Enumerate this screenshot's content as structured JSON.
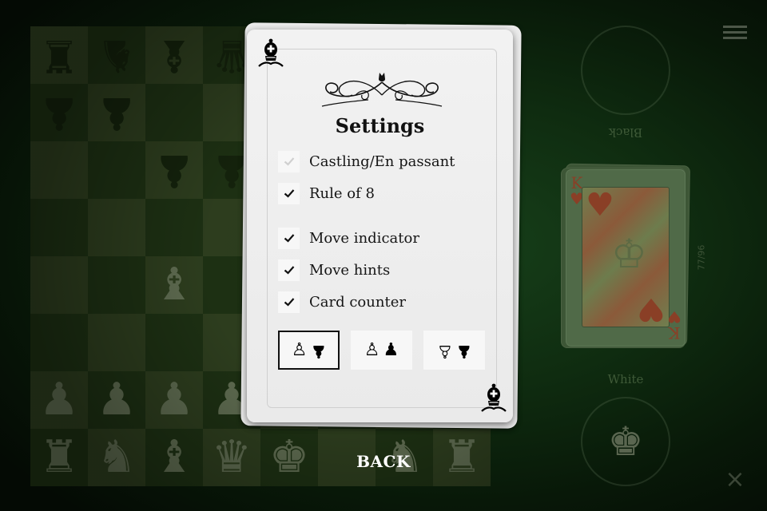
{
  "board": {
    "rows": [
      [
        "bR",
        "bN",
        "bB",
        "bQ",
        "",
        "",
        "",
        ""
      ],
      [
        "bP",
        "bP",
        "",
        "",
        "",
        "",
        "",
        ""
      ],
      [
        "",
        "",
        "bP",
        "bP",
        "",
        "",
        "",
        ""
      ],
      [
        "",
        "",
        "",
        "",
        "",
        "",
        "",
        ""
      ],
      [
        "",
        "",
        "wB",
        "",
        "",
        "",
        "",
        ""
      ],
      [
        "",
        "",
        "",
        "",
        "",
        "",
        "",
        ""
      ],
      [
        "wP",
        "wP",
        "wP",
        "wP",
        "",
        "",
        "",
        ""
      ],
      [
        "wR",
        "wN",
        "wB",
        "wQ",
        "wK",
        "",
        "wN",
        "wR"
      ]
    ],
    "glyphs": {
      "K": "♚",
      "Q": "♛",
      "R": "♜",
      "B": "♝",
      "N": "♞",
      "P": "♟"
    },
    "colors": {
      "light_square": "#2d3d1e",
      "dark_square": "#1d3013"
    }
  },
  "players": {
    "black": {
      "label": "Black",
      "icon": "empty-ring"
    },
    "white": {
      "label": "White",
      "icon": "king-icon",
      "glyph": "♚"
    }
  },
  "deck": {
    "top_card": {
      "rank": "K",
      "suit": "♥",
      "name": "King of Hearts"
    },
    "counter": "77/96"
  },
  "menu_icon": "hamburger-menu-icon",
  "close_icon": "×",
  "settings": {
    "title": "Settings",
    "options": [
      {
        "label": "Castling/En passant",
        "checked": true,
        "enabled": false
      },
      {
        "label": "Rule of 8",
        "checked": true,
        "enabled": true
      },
      {
        "label": "Move indicator",
        "checked": true,
        "enabled": true
      },
      {
        "label": "Move hints",
        "checked": true,
        "enabled": true
      },
      {
        "label": "Card counter",
        "checked": true,
        "enabled": true
      }
    ],
    "piece_orientation": {
      "selected_index": 0,
      "options": [
        {
          "name": "white-up-black-flipped",
          "white": "♙",
          "black": "♟",
          "white_flipped": false,
          "black_flipped": true
        },
        {
          "name": "both-upright",
          "white": "♙",
          "black": "♟",
          "white_flipped": false,
          "black_flipped": false
        },
        {
          "name": "both-flipped",
          "white": "♙",
          "black": "♟",
          "white_flipped": true,
          "black_flipped": true
        }
      ]
    }
  },
  "back_label": "BACK"
}
